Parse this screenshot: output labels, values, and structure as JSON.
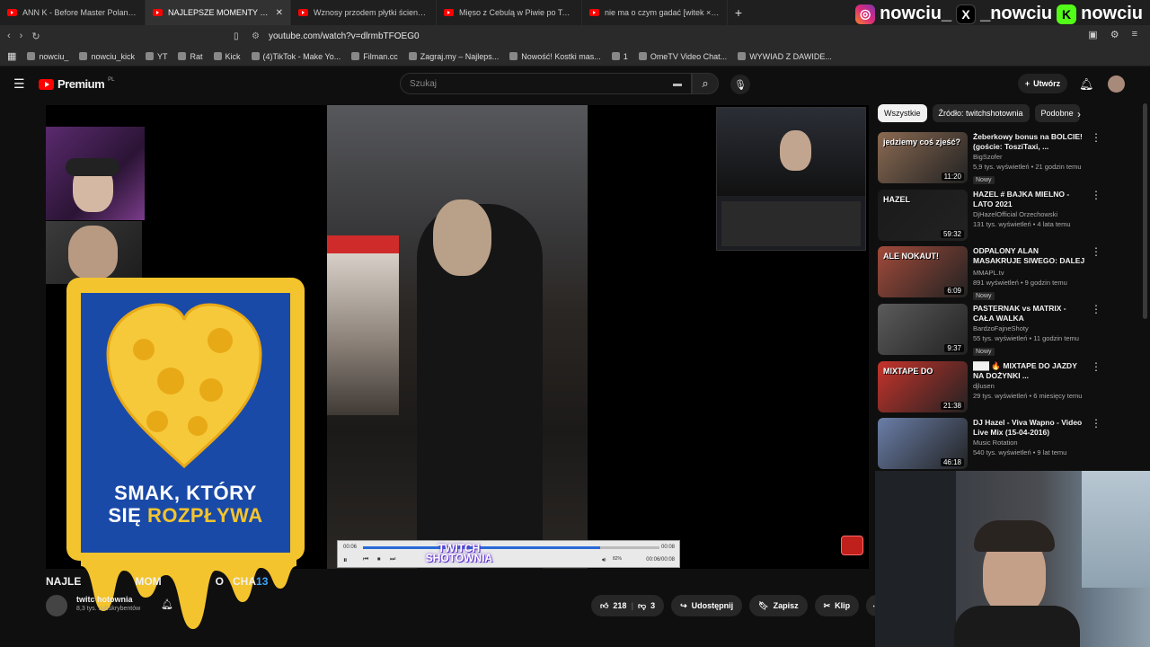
{
  "tabs": [
    {
      "title": "ANN K - Before Master Poland Dj Ba",
      "active": false
    },
    {
      "title": "NAJLEPSZE MOMENTY POLSK",
      "active": true
    },
    {
      "title": "Wznosy przodem płytki ścienne - Yo",
      "active": false
    },
    {
      "title": "Mięso z Cebulą w Piwie po Teksańsku",
      "active": false
    },
    {
      "title": "nie ma o czym gadać [witek × kasix",
      "active": false
    }
  ],
  "new_tab": "+",
  "tab_close": "✕",
  "social": [
    {
      "icon": "instagram-icon",
      "handle": "nowciu_",
      "glyph": "◎"
    },
    {
      "icon": "x-icon",
      "handle": "_nowciu",
      "glyph": "X"
    },
    {
      "icon": "kick-icon",
      "handle": "nowciu",
      "glyph": "K"
    }
  ],
  "url": "youtube.com/watch?v=dlrmbTFOEG0",
  "bookmarks": [
    "nowciu_",
    "nowciu_kick",
    "YT",
    "Rat",
    "Kick",
    "(4)TikTok - Make Yo...",
    "Filman.cc",
    "Zagraj.my – Najleps...",
    "Nowość! Kostki mas...",
    "1",
    "OmeTV Video Chat...",
    "WYWIAD Z DAWIDE..."
  ],
  "yt": {
    "logo": "Premium",
    "region": "PL",
    "search_placeholder": "Szukaj",
    "create_label": "Utwórz"
  },
  "video": {
    "title_parts": [
      "NAJLE",
      "MOM",
      "O",
      "CHA",
      "13"
    ],
    "channel": "twitc    hotownia",
    "subs": "8,3 tys. subskrybentów",
    "likes": "218",
    "dislikes": "3",
    "share": "Udostępnij",
    "save": "Zapisz",
    "clip": "Klip",
    "player_time_left": "00:06",
    "player_time_right": "00:08",
    "player_time_total": "00:06/00:08",
    "volume_pct": "82%",
    "watermark": "TWITCH\nSHOTOWNIA"
  },
  "ad": {
    "line1": "SMAK, KTÓRY",
    "line2a": "SIĘ ",
    "line2b": "ROZPŁYWA"
  },
  "chips": [
    "Wszystkie",
    "Źródło: twitchshotownia",
    "Podobne"
  ],
  "recs": [
    {
      "title": "Żeberkowy bonus na BOLCIE! (goście: TosziTaxi, ...",
      "channel": "BigSzofer",
      "meta": "5,9 tys. wyświetleń • 21 godzin temu",
      "badge": "Nowy",
      "dur": "11:20",
      "thumb": "#8a6a52",
      "thumb_text": "jedziemy coś zjeść?"
    },
    {
      "title": "HAZEL # BAJKA MIELNO - LATO 2021",
      "channel": "DjHazelOfficial Orzechowski",
      "meta": "131 tys. wyświetleń • 4 lata temu",
      "badge": "",
      "dur": "59:32",
      "thumb": "#1a1a1a",
      "thumb_text": "HAZEL"
    },
    {
      "title": "ODPALONY ALAN MASAKRUJE SIWEGO: DALEJ NIE MA JAJ, ...",
      "channel": "MMAPL.tv",
      "meta": "891 wyświetleń • 9 godzin temu",
      "badge": "Nowy",
      "dur": "6:09",
      "thumb": "#a14a3a",
      "thumb_text": "ALE NOKAUT!"
    },
    {
      "title": "PASTERNAK vs MATRIX - CAŁA WALKA",
      "channel": "BardzoFajneShoty",
      "meta": "55 tys. wyświetleń • 11 godzin temu",
      "badge": "Nowy",
      "dur": "9:37",
      "thumb": "#5b5b5b",
      "thumb_text": ""
    },
    {
      "title": "███ 🔥 MIXTAPE DO JAZDY NA DOŻYNKI ...",
      "channel": "djlusen",
      "meta": "29 tys. wyświetleń • 6 miesięcy temu",
      "badge": "",
      "dur": "21:38",
      "thumb": "#c6332b",
      "thumb_text": "MIXTAPE DO"
    },
    {
      "title": "DJ Hazel - Viva Wapno - Video Live Mix (15-04-2016)",
      "channel": "Music Rotation",
      "meta": "540 tys. wyświetleń • 9 lat temu",
      "badge": "",
      "dur": "46:18",
      "thumb": "#6a7ea8",
      "thumb_text": ""
    }
  ]
}
